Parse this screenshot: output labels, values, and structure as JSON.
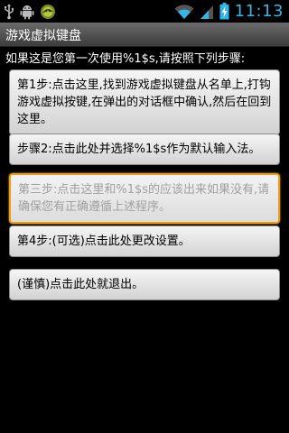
{
  "status_bar": {
    "icons": [
      "usb-icon",
      "android-debug-icon",
      "app-notification-icon"
    ],
    "time": "11:13",
    "time_color": "#33b5e5"
  },
  "title_bar": {
    "title": "游戏虚拟键盘"
  },
  "intro": "如果这是您第一次使用%1$s,请按照下列步骤:",
  "steps": [
    {
      "label": "第1步:点击这里,找到游戏虚拟键盘从名单上,打钩游戏虚拟按键,在弹出的对话框中确认,然后在回到这里。",
      "enabled": true
    },
    {
      "label": "步骤2:点击此处并选择%1$s作为默认输入法。",
      "enabled": true
    },
    {
      "label": "第三步:点击这里和%1$s的应该出来如果没有,请确保您有正确遵循上述程序。",
      "enabled": false
    },
    {
      "label": "第4步:(可选)点击此处更改设置。",
      "enabled": true
    },
    {
      "label": "(谨慎)点击此处就退出。",
      "enabled": true
    }
  ],
  "colors": {
    "focus_border": "#f09a1a",
    "disabled_text": "#a0a0a0"
  }
}
